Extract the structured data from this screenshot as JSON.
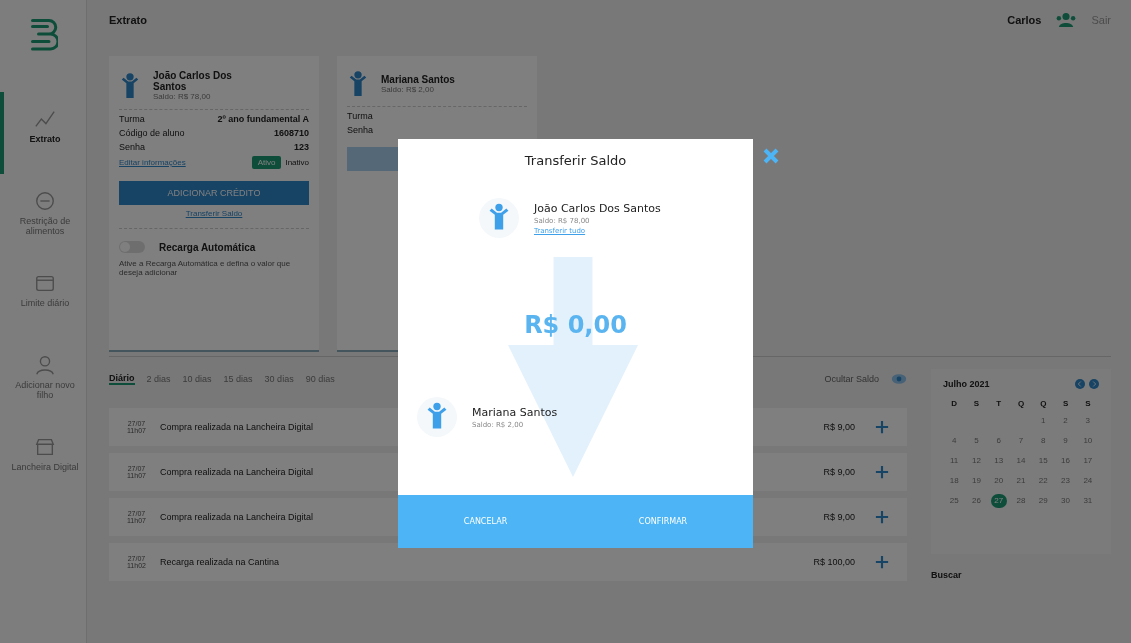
{
  "header": {
    "title": "Extrato",
    "user": "Carlos",
    "logout": "Sair"
  },
  "sidebar": {
    "items": [
      {
        "label": "Extrato",
        "selected": true
      },
      {
        "label": "Restrição de alimentos",
        "selected": false
      },
      {
        "label": "Limite diário",
        "selected": false
      },
      {
        "label": "Adicionar novo filho",
        "selected": false
      },
      {
        "label": "Lancheira Digital",
        "selected": false
      }
    ]
  },
  "cards": [
    {
      "name": "João Carlos Dos Santos",
      "balance": "Saldo: R$ 78,00",
      "fields": [
        {
          "label": "Turma",
          "value": "2º ano fundamental A"
        },
        {
          "label": "Código de aluno",
          "value": "1608710"
        },
        {
          "label": "Senha",
          "value": "123"
        }
      ],
      "edit_link": "Editar informações",
      "status_badge": "Ativo",
      "status_label": "Inativo",
      "credit_button": "ADICIONAR CRÉDITO",
      "transfer_link": "Transferir Saldo",
      "auto_recharge_on": false,
      "auto_title": "Recarga Automática",
      "auto_text": "Ative a Recarga Automática e defina o valor que deseja adicionar"
    },
    {
      "name": "Mariana Santos",
      "balance": "Saldo: R$ 2,00",
      "fields": [
        {
          "label": "Turma"
        },
        {
          "label": "Senha"
        }
      ]
    }
  ],
  "period_tabs": [
    {
      "label": "Diário",
      "selected": true
    },
    {
      "label": "2 dias",
      "selected": false
    },
    {
      "label": "10 dias",
      "selected": false
    },
    {
      "label": "15 dias",
      "selected": false
    },
    {
      "label": "30 dias",
      "selected": false
    },
    {
      "label": "90 dias",
      "selected": false
    }
  ],
  "hide_balance": "Ocultar Saldo",
  "transactions": [
    {
      "date": "27/07",
      "time": "11h07",
      "description": "Compra realizada na Lancheira Digital",
      "amount": "R$ 9,00"
    },
    {
      "date": "27/07",
      "time": "11h07",
      "description": "Compra realizada na Lancheira Digital",
      "amount": "R$ 9,00"
    },
    {
      "date": "27/07",
      "time": "11h07",
      "description": "Compra realizada na Lancheira Digital",
      "amount": "R$ 9,00"
    },
    {
      "date": "27/07",
      "time": "11h02",
      "description": "Recarga realizada na Cantina",
      "amount": "R$ 100,00"
    }
  ],
  "calendar": {
    "month": "Julho 2021",
    "weekdays": [
      "D",
      "S",
      "T",
      "Q",
      "Q",
      "S",
      "S"
    ],
    "weeks": [
      [
        {
          "day": "1",
          "selected": false
        },
        {
          "day": "2",
          "selected": false
        },
        {
          "day": "3",
          "selected": false
        }
      ],
      [
        {
          "day": "4",
          "selected": false
        },
        {
          "day": "5",
          "selected": false
        },
        {
          "day": "6",
          "selected": false
        },
        {
          "day": "7",
          "selected": false
        },
        {
          "day": "8",
          "selected": false
        },
        {
          "day": "9",
          "selected": false
        },
        {
          "day": "10",
          "selected": false
        }
      ],
      [
        {
          "day": "11",
          "selected": false
        },
        {
          "day": "12",
          "selected": false
        },
        {
          "day": "13",
          "selected": false
        },
        {
          "day": "14",
          "selected": false
        },
        {
          "day": "15",
          "selected": false
        },
        {
          "day": "16",
          "selected": false
        },
        {
          "day": "17",
          "selected": false
        }
      ],
      [
        {
          "day": "18",
          "selected": false
        },
        {
          "day": "19",
          "selected": false
        },
        {
          "day": "20",
          "selected": false
        },
        {
          "day": "21",
          "selected": false
        },
        {
          "day": "22",
          "selected": false
        },
        {
          "day": "23",
          "selected": false
        },
        {
          "day": "24",
          "selected": false
        }
      ],
      [
        {
          "day": "25",
          "selected": false
        },
        {
          "day": "26",
          "selected": false
        },
        {
          "day": "27",
          "selected": true
        },
        {
          "day": "28",
          "selected": false
        },
        {
          "day": "29",
          "selected": false
        },
        {
          "day": "30",
          "selected": false
        },
        {
          "day": "31",
          "selected": false
        }
      ]
    ]
  },
  "search_label": "Buscar",
  "modal": {
    "title": "Transferir Saldo",
    "from": {
      "name": "João Carlos Dos Santos",
      "balance": "Saldo: R$ 78,00",
      "link": "Transferir tudo"
    },
    "amount": "R$ 0,00",
    "to": {
      "name": "Mariana Santos",
      "balance": "Saldo: R$ 2,00"
    },
    "cancel": "CANCELAR",
    "confirm": "CONFIRMAR"
  }
}
